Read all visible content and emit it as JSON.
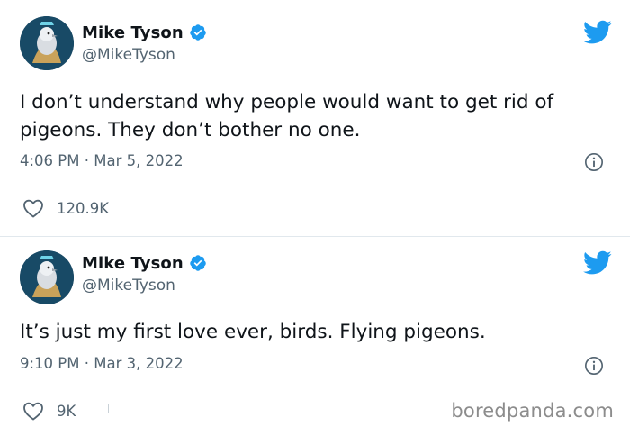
{
  "tweets": [
    {
      "author": {
        "name": "Mike Tyson",
        "handle": "@MikeTyson"
      },
      "text": "I don’t understand why people would want to get rid of pigeons. They don’t bother no one.",
      "timestamp": "4:06 PM · Mar 5, 2022",
      "likes": "120.9K"
    },
    {
      "author": {
        "name": "Mike Tyson",
        "handle": "@MikeTyson"
      },
      "text": "It’s just my first love ever, birds. Flying pigeons.",
      "timestamp": "9:10 PM · Mar 3, 2022",
      "likes": "9K"
    }
  ],
  "watermark": "boredpanda.com",
  "colors": {
    "twitter_blue": "#1d9bf0",
    "text": "#0f1419",
    "secondary": "#536471",
    "divider": "#e1e8ed"
  },
  "icons": [
    "avatar-pigeon",
    "verified-badge-icon",
    "twitter-bird-icon",
    "info-icon",
    "heart-icon"
  ]
}
